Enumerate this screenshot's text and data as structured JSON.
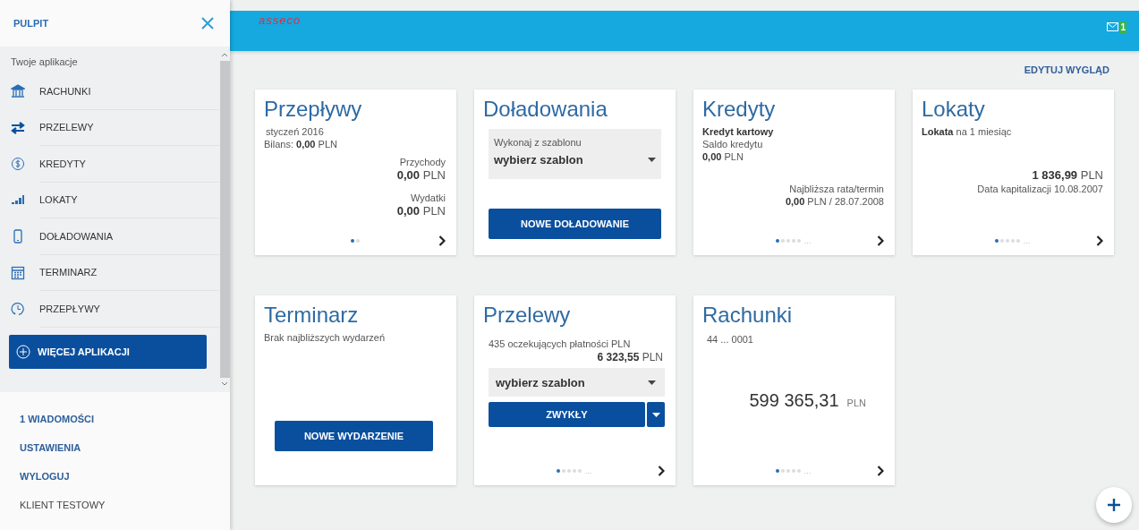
{
  "sidebar": {
    "title": "PULPIT",
    "section_label": "Twoje aplikacje",
    "items": [
      {
        "label": "RACHUNKI"
      },
      {
        "label": "PRZELEWY"
      },
      {
        "label": "KREDYTY"
      },
      {
        "label": "LOKATY"
      },
      {
        "label": "DOŁADOWANIA"
      },
      {
        "label": "TERMINARZ"
      },
      {
        "label": "PRZEPŁYWY"
      }
    ],
    "more_button": "WIĘCEJ APLIKACJI",
    "links": [
      {
        "label": "1 WIADOMOŚCI",
        "kind": "link"
      },
      {
        "label": "USTAWIENIA",
        "kind": "link"
      },
      {
        "label": "WYLOGUJ",
        "kind": "link"
      },
      {
        "label": "KLIENT TESTOWY",
        "kind": "user"
      }
    ]
  },
  "topbar": {
    "logo": "asseco",
    "mail_count": "1"
  },
  "edit_link": "EDYTUJ WYGLĄD",
  "cards": [
    {
      "kind": "flows",
      "title": "Przepływy",
      "period": "styczeń 2016",
      "balance": "Bilans: **0,00** PLN",
      "income_label": "Przychody",
      "income": "**0,00** PLN",
      "expense_label": "Wydatki",
      "expense": "**0,00** PLN",
      "pager": {
        "dots": [
          {
            "selected": true
          },
          {
            "selected": false
          }
        ]
      }
    },
    {
      "kind": "topup",
      "title": "Doładowania",
      "template_label": "Wykonaj z szablonu",
      "select_value": "wybierz szablon",
      "button": "NOWE DOŁADOWANIE"
    },
    {
      "kind": "credits",
      "title": "Kredyty",
      "name": "Kredyt kartowy",
      "balance_label": "Saldo kredytu",
      "balance": "**0,00** PLN",
      "next_label": "Najbliższa rata/termin",
      "next_value": "**0,00** PLN / 28.07.2008",
      "pager": {
        "dots": [
          {
            "selected": true
          },
          {
            "selected": false
          },
          {
            "selected": false
          },
          {
            "selected": false
          },
          {
            "selected": false
          }
        ],
        "more": "…"
      }
    },
    {
      "kind": "deposits",
      "title": "Lokaty",
      "name": "**Lokata** na 1 miesiąc",
      "amount": "**1 836,99** PLN",
      "capitalization": "Data kapitalizacji 10.08.2007",
      "pager": {
        "dots": [
          {
            "selected": true
          },
          {
            "selected": false
          },
          {
            "selected": false
          },
          {
            "selected": false
          },
          {
            "selected": false
          }
        ],
        "more": "…"
      }
    },
    {
      "kind": "calendar",
      "title": "Terminarz",
      "empty_text": "Brak najbliższych wydarzeń",
      "button": "NOWE WYDARZENIE"
    },
    {
      "kind": "transfers",
      "title": "Przelewy",
      "pending": "435 oczekujących płatności PLN",
      "amount": "**6 323,55** PLN",
      "select_value": "wybierz szablon",
      "button": "ZWYKŁY",
      "pager": {
        "dots": [
          {
            "selected": true
          },
          {
            "selected": false
          },
          {
            "selected": false
          },
          {
            "selected": false
          },
          {
            "selected": false
          }
        ],
        "more": "…"
      }
    },
    {
      "kind": "accounts",
      "title": "Rachunki",
      "number": "44 ... 0001",
      "amount": "599 365,31",
      "currency": "PLN",
      "pager": {
        "dots": [
          {
            "selected": true
          },
          {
            "selected": false
          },
          {
            "selected": false
          },
          {
            "selected": false
          },
          {
            "selected": false
          }
        ],
        "more": "…"
      }
    }
  ]
}
